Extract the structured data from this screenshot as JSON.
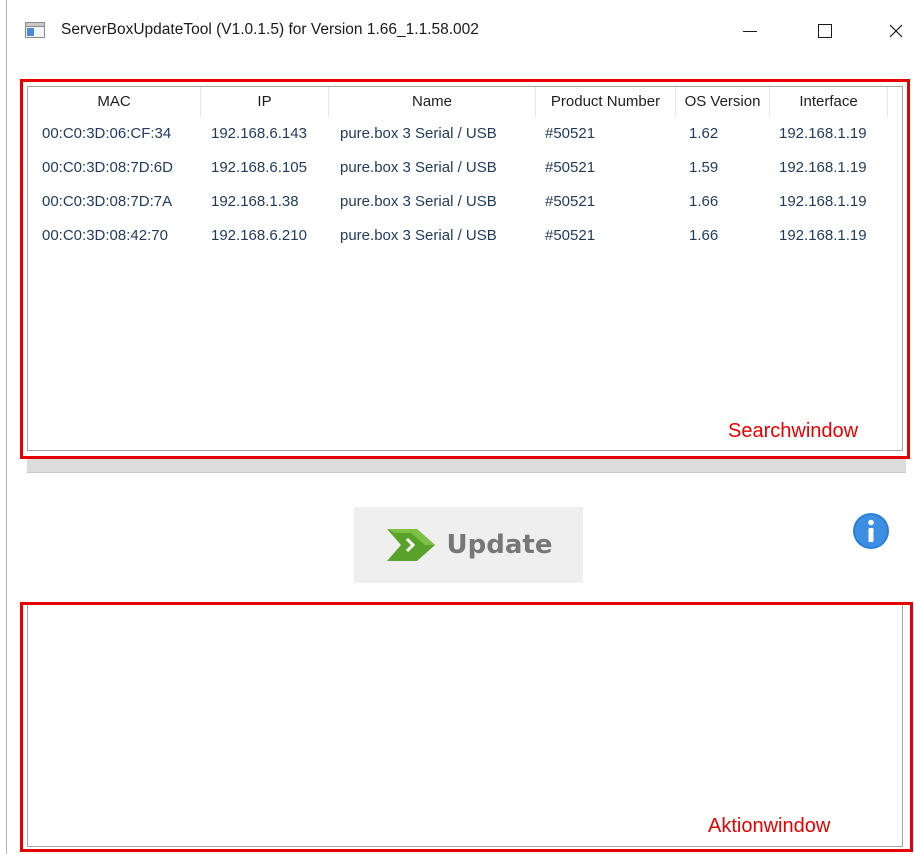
{
  "window": {
    "title": "ServerBoxUpdateTool (V1.0.1.5) for Version 1.66_1.1.58.002",
    "icon": "app-window-icon",
    "controls": [
      "minimize-icon",
      "maximize-icon",
      "close-icon"
    ]
  },
  "devices": {
    "columns": [
      "MAC",
      "IP",
      "Name",
      "Product Number",
      "OS Version",
      "Interface"
    ],
    "rows": [
      {
        "mac": "00:C0:3D:06:CF:34",
        "ip": "192.168.6.143",
        "name": "pure.box 3 Serial / USB",
        "product": "#50521",
        "os": "1.62",
        "iface": "192.168.1.19"
      },
      {
        "mac": "00:C0:3D:08:7D:6D",
        "ip": "192.168.6.105",
        "name": "pure.box 3 Serial / USB",
        "product": "#50521",
        "os": "1.59",
        "iface": "192.168.1.19"
      },
      {
        "mac": "00:C0:3D:08:7D:7A",
        "ip": "192.168.1.38",
        "name": "pure.box 3 Serial / USB",
        "product": "#50521",
        "os": "1.66",
        "iface": "192.168.1.19"
      },
      {
        "mac": "00:C0:3D:08:42:70",
        "ip": "192.168.6.210",
        "name": "pure.box 3 Serial / USB",
        "product": "#50521",
        "os": "1.66",
        "iface": "192.168.1.19"
      }
    ]
  },
  "annotations": {
    "search": "Searchwindow",
    "action": "Aktionwindow",
    "color": "#e60000"
  },
  "actions": {
    "update_label": "Update",
    "update_icon": "arrow-right-icon",
    "info_icon": "info-icon",
    "info_color": "#2b7fd9"
  }
}
